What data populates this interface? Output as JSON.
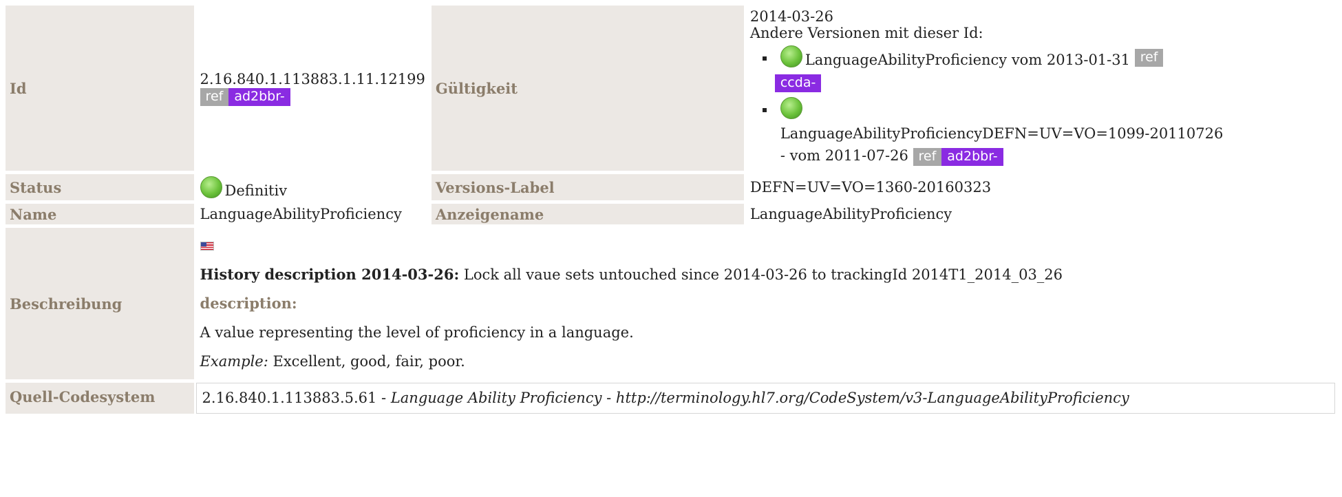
{
  "rows": {
    "id": {
      "label": "Id",
      "value": "2.16.840.1.113883.1.11.12199",
      "ref_badge": "ref",
      "prefix_badge": "ad2bbr-"
    },
    "validity": {
      "label": "Gültigkeit",
      "date": "2014-03-26",
      "other_versions_label": "Andere Versionen mit dieser Id:",
      "versions": [
        {
          "name": "LanguageAbilityProficiency vom 2013-01-31",
          "ref_badge": "ref",
          "prefix_badge": "ccda-"
        },
        {
          "name": "LanguageAbilityProficiencyDEFN=UV=VO=1099-20110726",
          "suffix": "- vom 2011-07-26",
          "ref_badge": "ref",
          "prefix_badge": "ad2bbr-"
        }
      ]
    },
    "status": {
      "label": "Status",
      "value": "Definitiv"
    },
    "version_label": {
      "label": "Versions-Label",
      "value": "DEFN=UV=VO=1360-20160323"
    },
    "name": {
      "label": "Name",
      "value": "LanguageAbilityProficiency"
    },
    "display_name": {
      "label": "Anzeigename",
      "value": "LanguageAbilityProficiency"
    },
    "description": {
      "label": "Beschreibung",
      "language_flag_icon": "us-flag-icon",
      "history_heading": "History description 2014-03-26:",
      "history_text": " Lock all vaue sets untouched since 2014-03-26 to trackingId 2014T1_2014_03_26",
      "sub_heading": "description:",
      "text": "A value representing the level of proficiency in a language.",
      "example_label": "Example:",
      "example_text": " Excellent, good, fair, poor."
    },
    "source_codesystem": {
      "label": "Quell-Codesystem",
      "oid": "2.16.840.1.113883.5.61",
      "separator1": " - ",
      "name": "Language Ability Proficiency",
      "separator2": " - ",
      "uri": "http://terminology.hl7.org/CodeSystem/v3-LanguageAbilityProficiency"
    }
  },
  "colors": {
    "label_bg": "#ece8e4",
    "label_text": "#8b7d6b",
    "ref_badge": "#a7a7a7",
    "prefix_badge": "#8a2be2",
    "status_dot": "#6bc23a"
  }
}
